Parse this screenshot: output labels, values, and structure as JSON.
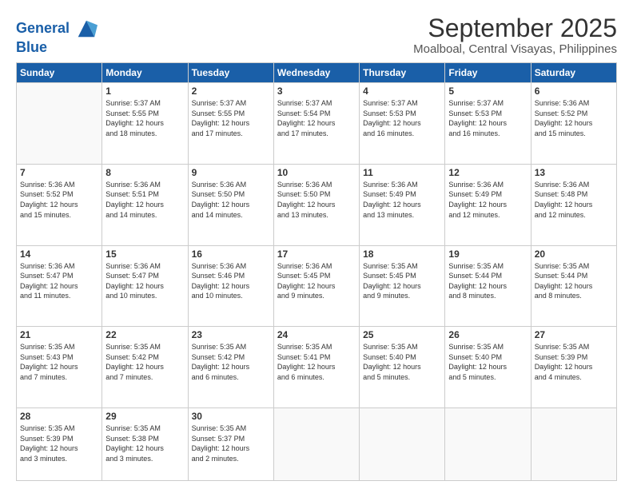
{
  "header": {
    "logo_line1": "General",
    "logo_line2": "Blue",
    "title": "September 2025",
    "subtitle": "Moalboal, Central Visayas, Philippines"
  },
  "weekdays": [
    "Sunday",
    "Monday",
    "Tuesday",
    "Wednesday",
    "Thursday",
    "Friday",
    "Saturday"
  ],
  "weeks": [
    [
      {
        "day": "",
        "info": ""
      },
      {
        "day": "1",
        "info": "Sunrise: 5:37 AM\nSunset: 5:55 PM\nDaylight: 12 hours\nand 18 minutes."
      },
      {
        "day": "2",
        "info": "Sunrise: 5:37 AM\nSunset: 5:55 PM\nDaylight: 12 hours\nand 17 minutes."
      },
      {
        "day": "3",
        "info": "Sunrise: 5:37 AM\nSunset: 5:54 PM\nDaylight: 12 hours\nand 17 minutes."
      },
      {
        "day": "4",
        "info": "Sunrise: 5:37 AM\nSunset: 5:53 PM\nDaylight: 12 hours\nand 16 minutes."
      },
      {
        "day": "5",
        "info": "Sunrise: 5:37 AM\nSunset: 5:53 PM\nDaylight: 12 hours\nand 16 minutes."
      },
      {
        "day": "6",
        "info": "Sunrise: 5:36 AM\nSunset: 5:52 PM\nDaylight: 12 hours\nand 15 minutes."
      }
    ],
    [
      {
        "day": "7",
        "info": "Sunrise: 5:36 AM\nSunset: 5:52 PM\nDaylight: 12 hours\nand 15 minutes."
      },
      {
        "day": "8",
        "info": "Sunrise: 5:36 AM\nSunset: 5:51 PM\nDaylight: 12 hours\nand 14 minutes."
      },
      {
        "day": "9",
        "info": "Sunrise: 5:36 AM\nSunset: 5:50 PM\nDaylight: 12 hours\nand 14 minutes."
      },
      {
        "day": "10",
        "info": "Sunrise: 5:36 AM\nSunset: 5:50 PM\nDaylight: 12 hours\nand 13 minutes."
      },
      {
        "day": "11",
        "info": "Sunrise: 5:36 AM\nSunset: 5:49 PM\nDaylight: 12 hours\nand 13 minutes."
      },
      {
        "day": "12",
        "info": "Sunrise: 5:36 AM\nSunset: 5:49 PM\nDaylight: 12 hours\nand 12 minutes."
      },
      {
        "day": "13",
        "info": "Sunrise: 5:36 AM\nSunset: 5:48 PM\nDaylight: 12 hours\nand 12 minutes."
      }
    ],
    [
      {
        "day": "14",
        "info": "Sunrise: 5:36 AM\nSunset: 5:47 PM\nDaylight: 12 hours\nand 11 minutes."
      },
      {
        "day": "15",
        "info": "Sunrise: 5:36 AM\nSunset: 5:47 PM\nDaylight: 12 hours\nand 10 minutes."
      },
      {
        "day": "16",
        "info": "Sunrise: 5:36 AM\nSunset: 5:46 PM\nDaylight: 12 hours\nand 10 minutes."
      },
      {
        "day": "17",
        "info": "Sunrise: 5:36 AM\nSunset: 5:45 PM\nDaylight: 12 hours\nand 9 minutes."
      },
      {
        "day": "18",
        "info": "Sunrise: 5:35 AM\nSunset: 5:45 PM\nDaylight: 12 hours\nand 9 minutes."
      },
      {
        "day": "19",
        "info": "Sunrise: 5:35 AM\nSunset: 5:44 PM\nDaylight: 12 hours\nand 8 minutes."
      },
      {
        "day": "20",
        "info": "Sunrise: 5:35 AM\nSunset: 5:44 PM\nDaylight: 12 hours\nand 8 minutes."
      }
    ],
    [
      {
        "day": "21",
        "info": "Sunrise: 5:35 AM\nSunset: 5:43 PM\nDaylight: 12 hours\nand 7 minutes."
      },
      {
        "day": "22",
        "info": "Sunrise: 5:35 AM\nSunset: 5:42 PM\nDaylight: 12 hours\nand 7 minutes."
      },
      {
        "day": "23",
        "info": "Sunrise: 5:35 AM\nSunset: 5:42 PM\nDaylight: 12 hours\nand 6 minutes."
      },
      {
        "day": "24",
        "info": "Sunrise: 5:35 AM\nSunset: 5:41 PM\nDaylight: 12 hours\nand 6 minutes."
      },
      {
        "day": "25",
        "info": "Sunrise: 5:35 AM\nSunset: 5:40 PM\nDaylight: 12 hours\nand 5 minutes."
      },
      {
        "day": "26",
        "info": "Sunrise: 5:35 AM\nSunset: 5:40 PM\nDaylight: 12 hours\nand 5 minutes."
      },
      {
        "day": "27",
        "info": "Sunrise: 5:35 AM\nSunset: 5:39 PM\nDaylight: 12 hours\nand 4 minutes."
      }
    ],
    [
      {
        "day": "28",
        "info": "Sunrise: 5:35 AM\nSunset: 5:39 PM\nDaylight: 12 hours\nand 3 minutes."
      },
      {
        "day": "29",
        "info": "Sunrise: 5:35 AM\nSunset: 5:38 PM\nDaylight: 12 hours\nand 3 minutes."
      },
      {
        "day": "30",
        "info": "Sunrise: 5:35 AM\nSunset: 5:37 PM\nDaylight: 12 hours\nand 2 minutes."
      },
      {
        "day": "",
        "info": ""
      },
      {
        "day": "",
        "info": ""
      },
      {
        "day": "",
        "info": ""
      },
      {
        "day": "",
        "info": ""
      }
    ]
  ]
}
